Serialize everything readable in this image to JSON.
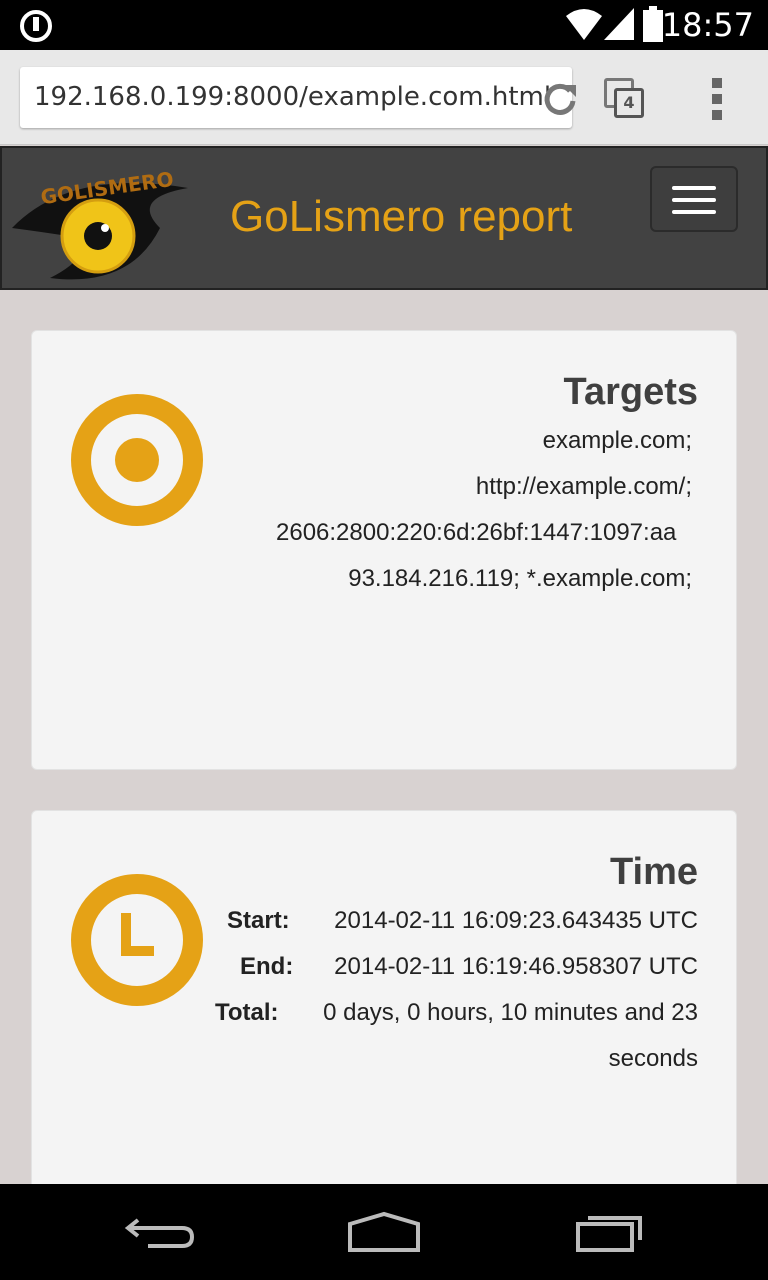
{
  "status_bar": {
    "time": "18:57",
    "icons": [
      "notification-icon",
      "wifi-icon",
      "signal-icon",
      "battery-icon"
    ]
  },
  "browser": {
    "url": "192.168.0.199:8000/example.com.html",
    "tab_count": "4",
    "icons": [
      "reload-icon",
      "tabs-icon",
      "overflow-menu-icon"
    ]
  },
  "site": {
    "logo_text": "GOLISMERO",
    "title": "GoLismero report",
    "accent_color": "#e5a216"
  },
  "targets": {
    "heading": "Targets",
    "items": [
      "example.com;",
      "http://example.com/;",
      "2606:2800:220:6d:26bf:1447:1097:aa",
      "93.184.216.119; *.example.com;"
    ]
  },
  "time": {
    "heading": "Time",
    "start_label": "Start:",
    "start_value": "2014-02-11 16:09:23.643435 UTC",
    "end_label": "End:",
    "end_value": "2014-02-11 16:19:46.958307 UTC",
    "total_label": "Total:",
    "total_value_line1": "0 days, 0 hours, 10 minutes and 23",
    "total_value_line2": "seconds"
  }
}
